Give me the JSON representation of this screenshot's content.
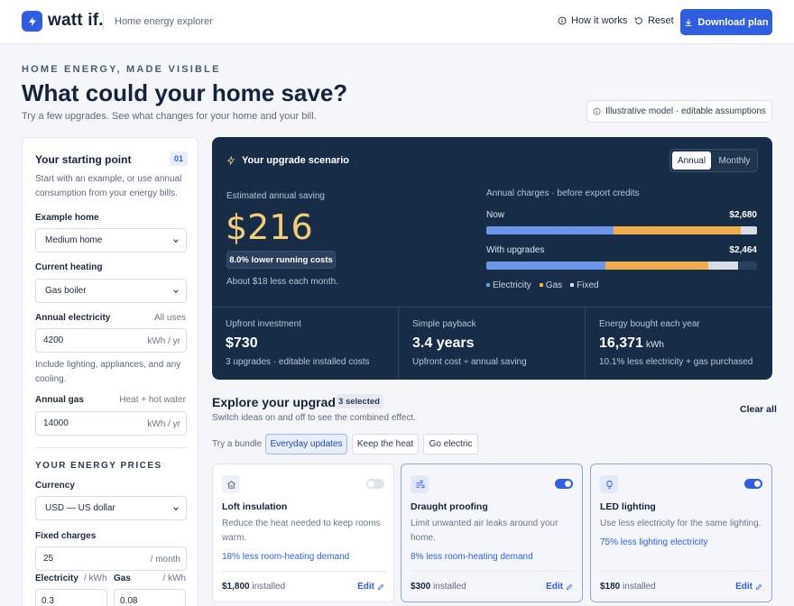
{
  "header": {
    "logo_text": "watt if.",
    "subtitle": "Home energy explorer",
    "how_it_works": "How it works",
    "reset": "Reset",
    "download": "Download plan"
  },
  "hero": {
    "eyebrow": "HOME ENERGY, MADE VISIBLE",
    "title": "What could your home save?",
    "subtitle": "Try a few upgrades. See what changes for your home and your bill.",
    "badge": "Illustrative model · editable assumptions"
  },
  "starting_point": {
    "title": "Your starting point",
    "step": "01",
    "description": "Start with an example, or use annual consumption from your energy bills.",
    "example_home_label": "Example home",
    "example_home_value": "Medium home",
    "heating_label": "Current heating",
    "heating_value": "Gas boiler",
    "electricity_label": "Annual electricity",
    "electricity_hint": "All uses",
    "electricity_value": "4200",
    "electricity_unit": "kWh / yr",
    "electricity_note": "Include lighting, appliances, and any cooling.",
    "gas_label": "Annual gas",
    "gas_hint": "Heat + hot water",
    "gas_value": "14000",
    "gas_unit": "kWh / yr",
    "prices_section": "YOUR ENERGY PRICES",
    "currency_label": "Currency",
    "currency_value": "USD — US dollar",
    "fixed_label": "Fixed charges",
    "fixed_value": "25",
    "fixed_unit": "/ month",
    "elec_price_label": "Electricity",
    "elec_price_unit": "/ kWh",
    "elec_price_value": "0.3",
    "gas_price_label": "Gas",
    "gas_price_unit": "/ kWh",
    "gas_price_value": "0.08"
  },
  "scenario": {
    "title": "Your upgrade scenario",
    "toggle_annual": "Annual",
    "toggle_monthly": "Monthly",
    "saving_label": "Estimated annual saving",
    "saving_value": "$216",
    "lower_pill": "8.0% lower running costs",
    "monthly_note": "About $18 less each month.",
    "charges_title": "Annual charges · before export credits",
    "now_label": "Now",
    "now_value": "$2,680",
    "with_label": "With upgrades",
    "with_value": "$2,464",
    "legend": [
      "Electricity",
      "Gas",
      "Fixed"
    ],
    "colors": {
      "electricity": "#6d95ea",
      "gas": "#f0ad4e",
      "fixed": "#d9dee6"
    },
    "bars": {
      "now": {
        "electricity": 0.47,
        "gas": 0.47,
        "fixed": 0.11
      },
      "with": {
        "electricity": 0.44,
        "gas": 0.38,
        "fixed": 0.11
      }
    },
    "stats": [
      {
        "label": "Upfront investment",
        "value": "$730",
        "unit": "",
        "note": "3 upgrades · editable installed costs"
      },
      {
        "label": "Simple payback",
        "value": "3.4 years",
        "unit": "",
        "note": "Upfront cost ÷ annual saving"
      },
      {
        "label": "Energy bought each year",
        "value": "16,371",
        "unit": "kWh",
        "note": "10.1% less electricity + gas purchased"
      }
    ]
  },
  "explore": {
    "title": "Explore your upgrades",
    "count": "3 selected",
    "subtitle": "Switch ideas on and off to see the combined effect.",
    "clear_all": "Clear all",
    "bundle_label": "Try a bundle",
    "bundles": [
      "Everyday updates",
      "Keep the heat",
      "Go electric"
    ],
    "cards": [
      {
        "title": "Loft insulation",
        "desc": "Reduce the heat needed to keep rooms warm.",
        "impact": "18% less room-heating demand",
        "cost": "$1,800",
        "cost_suffix": "installed",
        "edit": "Edit",
        "on": false,
        "icon": "house-icon"
      },
      {
        "title": "Draught proofing",
        "desc": "Limit unwanted air leaks around your home.",
        "impact": "8% less room-heating demand",
        "cost": "$300",
        "cost_suffix": "installed",
        "edit": "Edit",
        "on": true,
        "icon": "wind-icon"
      },
      {
        "title": "LED lighting",
        "desc": "Use less electricity for the same lighting.",
        "impact": "75% less lighting electricity",
        "cost": "$180",
        "cost_suffix": "installed",
        "edit": "Edit",
        "on": true,
        "icon": "lightbulb-icon"
      }
    ]
  }
}
